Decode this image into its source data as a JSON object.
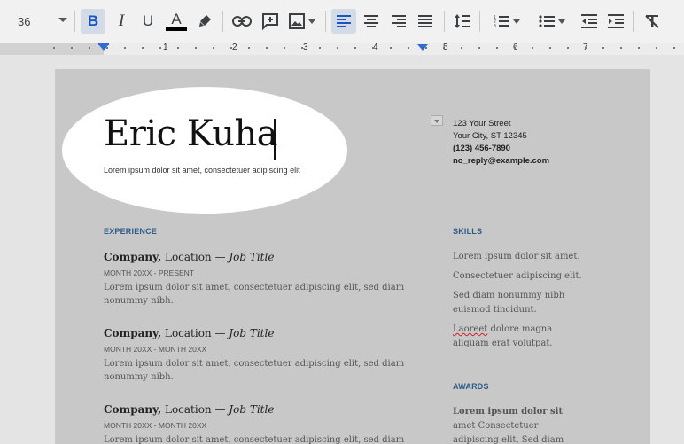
{
  "toolbar": {
    "font_size": "36",
    "bold_label": "B",
    "italic_label": "I",
    "underline_label": "U",
    "text_color_label": "A",
    "accent": "#2f6dd2"
  },
  "ruler": {
    "numbers": [
      "1",
      "2",
      "3",
      "4",
      "5",
      "6",
      "7"
    ]
  },
  "header": {
    "name": "Eric Kuha",
    "tagline": "Lorem ipsum dolor sit amet, consectetuer adipiscing elit",
    "contact": {
      "street": "123 Your Street",
      "city": "Your City, ST 12345",
      "phone": "(123) 456-7890",
      "email": "no_reply@example.com"
    }
  },
  "experience": {
    "heading": "EXPERIENCE",
    "jobs": [
      {
        "company": "Company,",
        "location": " Location — ",
        "job_title": "Job Title",
        "dates": "MONTH 20XX - PRESENT",
        "description": "Lorem ipsum dolor sit amet, consectetuer adipiscing elit, sed diam nonummy nibh."
      },
      {
        "company": "Company,",
        "location": " Location — ",
        "job_title": "Job Title",
        "dates": "MONTH 20XX - MONTH 20XX",
        "description": "Lorem ipsum dolor sit amet, consectetuer adipiscing elit, sed diam nonummy nibh."
      },
      {
        "company": "Company,",
        "location": " Location — ",
        "job_title": "Job Title",
        "dates": "MONTH 20XX - MONTH 20XX",
        "description": "Lorem ipsum dolor sit amet, consectetuer adipiscing elit, sed diam"
      }
    ]
  },
  "skills": {
    "heading": "SKILLS",
    "items": [
      "Lorem ipsum dolor sit amet.",
      "Consectetuer adipiscing elit.",
      "Sed diam nonummy nibh euismod tincidunt."
    ],
    "last_item_misspelled": "Laoreet",
    "last_item_rest": " dolore magna aliquam erat volutpat."
  },
  "awards": {
    "heading": "AWARDS",
    "bold": "Lorem ipsum dolor sit",
    "rest": " amet Consectetuer adipiscing elit, Sed diam nonummy"
  }
}
